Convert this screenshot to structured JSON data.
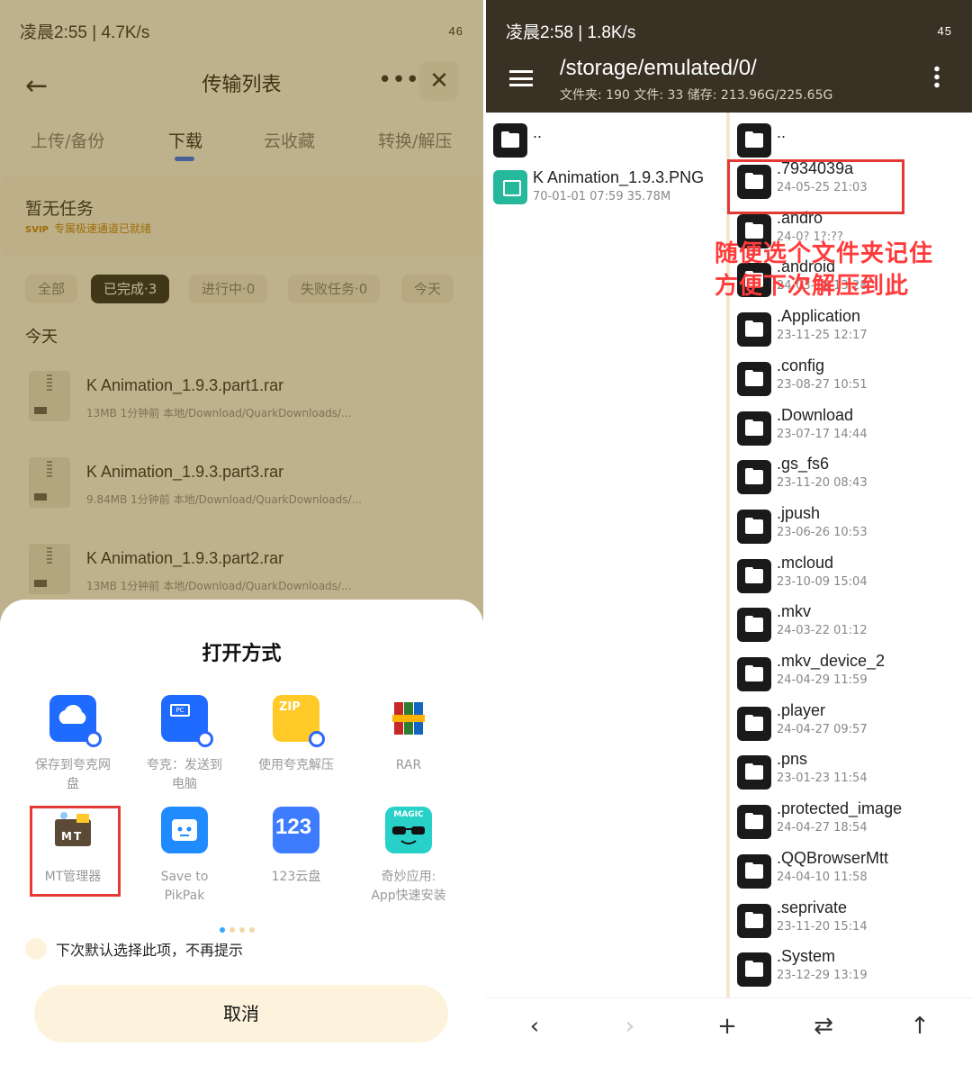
{
  "left": {
    "status": {
      "time": "凌晨2:55 | 4.7K/s",
      "battery": "46"
    },
    "header": {
      "title": "传输列表"
    },
    "tabs": [
      "上传/备份",
      "下载",
      "云收藏",
      "转换/解压"
    ],
    "task": {
      "title": "暂无任务",
      "svip": "SVIP",
      "subtitle": "专属极速通道已就绪"
    },
    "filters": [
      "全部",
      "已完成·3",
      "进行中·0",
      "失败任务·0",
      "今天"
    ],
    "today": "今天",
    "files": [
      {
        "name": "K Animation_1.9.3.part1.rar",
        "meta": "13MB  1分钟前  本地/Download/QuarkDownloads/..."
      },
      {
        "name": "K Animation_1.9.3.part3.rar",
        "meta": "9.84MB  1分钟前  本地/Download/QuarkDownloads/..."
      },
      {
        "name": "K Animation_1.9.3.part2.rar",
        "meta": "13MB  1分钟前  本地/Download/QuarkDownloads/..."
      }
    ],
    "sheet": {
      "title": "打开方式",
      "apps": [
        {
          "l1": "保存到夸克网",
          "l2": "盘"
        },
        {
          "l1": "夸克：发送到",
          "l2": "电脑"
        },
        {
          "l1": "使用夸克解压",
          "l2": ""
        },
        {
          "l1": "RAR",
          "l2": ""
        },
        {
          "l1": "MT管理器",
          "l2": ""
        },
        {
          "l1": "Save to PikPak",
          "l2": ""
        },
        {
          "l1": "123云盘",
          "l2": ""
        },
        {
          "l1": "奇妙应用:",
          "l2": "App快速安装"
        }
      ],
      "icons": {
        "pc": "PC",
        "zip": "ZIP",
        "mt": "MT",
        "n123": "123",
        "magic": "MAGIC"
      },
      "remember": "下次默认选择此项，不再提示",
      "cancel": "取消"
    }
  },
  "right": {
    "status": {
      "time": "凌晨2:58 | 1.8K/s",
      "battery": "45"
    },
    "path": "/storage/emulated/0/",
    "info": "文件夹: 190  文件: 33  储存: 213.96G/225.65G",
    "colL": [
      {
        "name": "..",
        "date": "",
        "type": "folder"
      },
      {
        "name": "K Animation_1.9.3.PNG",
        "date": "70-01-01 07:59  35.78M",
        "type": "png"
      }
    ],
    "colR": [
      {
        "name": "..",
        "date": ""
      },
      {
        "name": ".7934039a",
        "date": "24-05-25 21:03"
      },
      {
        "name": ".andro",
        "date": "24-0? 1?:??"
      },
      {
        "name": ".android",
        "date": "24-03-18 13:28"
      },
      {
        "name": ".Application",
        "date": "23-11-25 12:17"
      },
      {
        "name": ".config",
        "date": "23-08-27 10:51"
      },
      {
        "name": ".Download",
        "date": "23-07-17 14:44"
      },
      {
        "name": ".gs_fs6",
        "date": "23-11-20 08:43"
      },
      {
        "name": ".jpush",
        "date": "23-06-26 10:53"
      },
      {
        "name": ".mcloud",
        "date": "23-10-09 15:04"
      },
      {
        "name": ".mkv",
        "date": "24-03-22 01:12"
      },
      {
        "name": ".mkv_device_2",
        "date": "24-04-29 11:59"
      },
      {
        "name": ".player",
        "date": "24-04-27 09:57"
      },
      {
        "name": ".pns",
        "date": "23-01-23 11:54"
      },
      {
        "name": ".protected_image",
        "date": "24-04-27 18:54"
      },
      {
        "name": ".QQBrowserMtt",
        "date": "24-04-10 11:58"
      },
      {
        "name": ".seprivate",
        "date": "23-11-20 15:14"
      },
      {
        "name": ".System",
        "date": "23-12-29 13:19"
      }
    ],
    "annotation": [
      "随便选个文件夹记住",
      "方便下次解压到此"
    ],
    "nav": {
      "back": "‹",
      "forward": "›",
      "add": "+",
      "swap": "⇄",
      "up": "↑"
    }
  }
}
